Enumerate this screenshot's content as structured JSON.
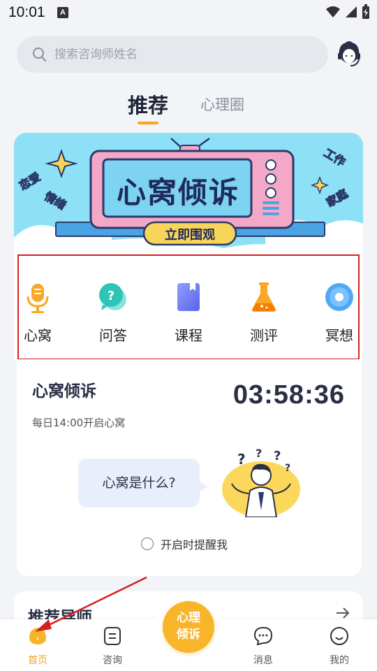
{
  "status_bar": {
    "time": "10:01",
    "notification_icon": "A"
  },
  "search": {
    "placeholder": "搜索咨询师姓名"
  },
  "tabs": [
    {
      "label": "推荐"
    },
    {
      "label": "心理圈"
    }
  ],
  "banner": {
    "title": "心窝倾诉",
    "button": "立即围观",
    "tags_left": [
      "恋爱",
      "情绪"
    ],
    "tags_right": [
      "工作",
      "家庭"
    ]
  },
  "features": [
    {
      "label": "心窝",
      "icon": "microphone-icon"
    },
    {
      "label": "问答",
      "icon": "question-bubble-icon"
    },
    {
      "label": "课程",
      "icon": "book-icon"
    },
    {
      "label": "测评",
      "icon": "flask-icon"
    },
    {
      "label": "冥想",
      "icon": "disc-icon"
    }
  ],
  "heart_card": {
    "title": "心窝倾诉",
    "subtitle": "每日14:00开启心窝",
    "countdown": "03:58:36",
    "bubble": "心窝是什么?",
    "remind_label": "开启时提醒我"
  },
  "recommend": {
    "title": "推荐导师"
  },
  "nav": {
    "items": [
      {
        "label": "首页",
        "icon": "home-icon"
      },
      {
        "label": "咨询",
        "icon": "consult-icon"
      },
      {
        "label": "消息",
        "icon": "message-icon"
      },
      {
        "label": "我的",
        "icon": "profile-icon"
      }
    ],
    "center_label_line1": "心理",
    "center_label_line2": "倾诉"
  },
  "colors": {
    "accent": "#f5a623",
    "banner_bg": "#8ee0f7",
    "highlight_box": "#d42020",
    "annotation_arrow": "#d42020"
  }
}
